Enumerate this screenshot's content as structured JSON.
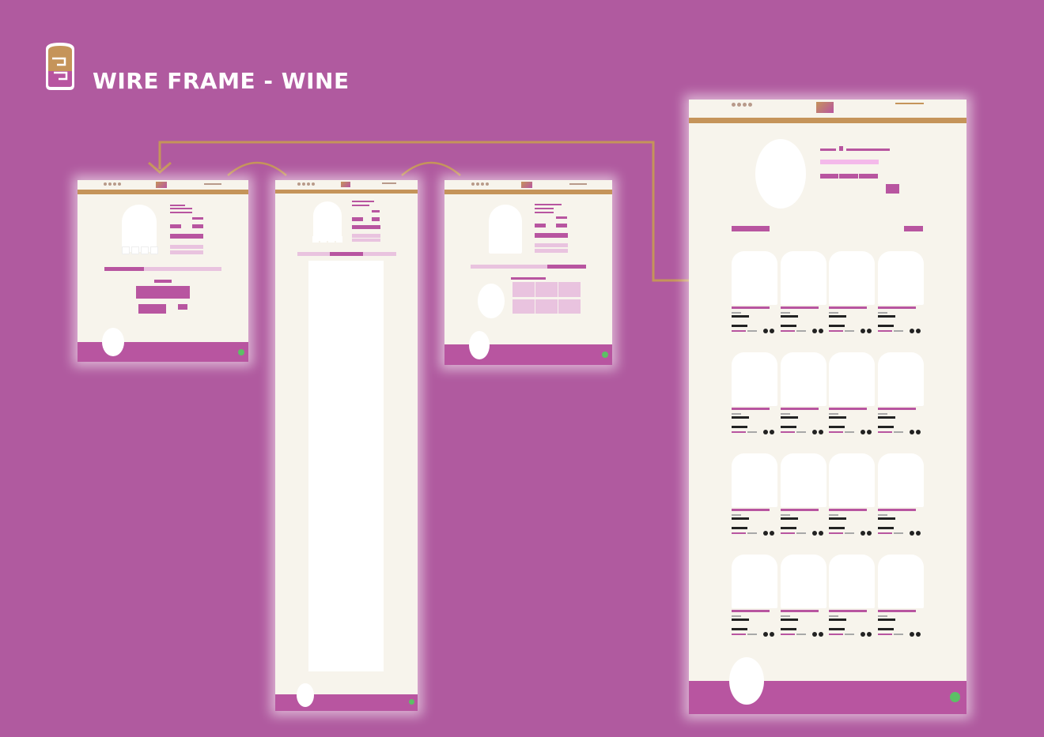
{
  "header": {
    "title": "WIRE FRAME - WINE",
    "logo_icon": "wine-cork-logo-icon"
  },
  "colors": {
    "background": "#b05a9f",
    "frame": "#f7f4ec",
    "accent_gold": "#c5945a",
    "accent_magenta": "#b855a0",
    "light_pink": "#e9c3df",
    "status_green": "#5cc065"
  },
  "frames": [
    {
      "id": "product-detail-page"
    },
    {
      "id": "product-detail-long-page"
    },
    {
      "id": "product-detail-review-page"
    },
    {
      "id": "product-list-page",
      "product_rows": 4,
      "products_per_row": 4
    }
  ]
}
